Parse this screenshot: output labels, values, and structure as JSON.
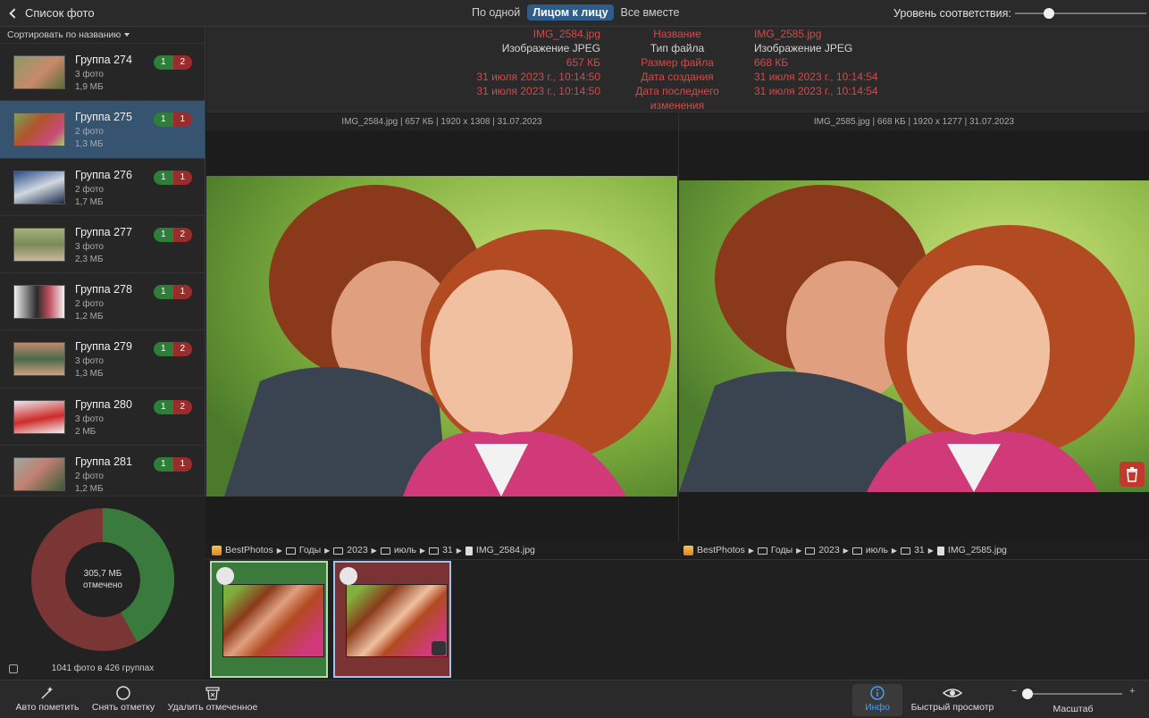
{
  "topbar": {
    "back_label": "Список фото",
    "modes": [
      {
        "label": "По одной",
        "active": false
      },
      {
        "label": "Лицом к лицу",
        "active": true
      },
      {
        "label": "Все вместе",
        "active": false
      }
    ],
    "match_level_label": "Уровень соответствия:",
    "match_level": 0.25
  },
  "sidebar": {
    "sort_label": "Сортировать по названию",
    "groups": [
      {
        "name": "Группа 274",
        "count": "3 фото",
        "size": "1,9 МБ",
        "keep": "1",
        "remove": "2",
        "selected": false
      },
      {
        "name": "Группа 275",
        "count": "2 фото",
        "size": "1,3 МБ",
        "keep": "1",
        "remove": "1",
        "selected": true
      },
      {
        "name": "Группа 276",
        "count": "2 фото",
        "size": "1,7 МБ",
        "keep": "1",
        "remove": "1",
        "selected": false
      },
      {
        "name": "Группа 277",
        "count": "3 фото",
        "size": "2,3 МБ",
        "keep": "1",
        "remove": "2",
        "selected": false
      },
      {
        "name": "Группа 278",
        "count": "2 фото",
        "size": "1,2 МБ",
        "keep": "1",
        "remove": "1",
        "selected": false
      },
      {
        "name": "Группа 279",
        "count": "3 фото",
        "size": "1,3 МБ",
        "keep": "1",
        "remove": "2",
        "selected": false
      },
      {
        "name": "Группа 280",
        "count": "3 фото",
        "size": "2 МБ",
        "keep": "1",
        "remove": "2",
        "selected": false
      },
      {
        "name": "Группа 281",
        "count": "2 фото",
        "size": "1,2 МБ",
        "keep": "1",
        "remove": "1",
        "selected": false
      }
    ],
    "donut": {
      "marked_label": "305,7 МБ",
      "marked_sub": "отмечено",
      "keep_fraction": 0.42,
      "colors": {
        "keep": "#3a7a3c",
        "remove": "#7a3535"
      }
    },
    "total_label": "1041 фото в 426 группах"
  },
  "info": {
    "rows": [
      {
        "left": "IMG_2584.jpg",
        "label": "Название",
        "right": "IMG_2585.jpg",
        "diff": true
      },
      {
        "left": "Изображение JPEG",
        "label": "Тип файла",
        "right": "Изображение JPEG",
        "diff": false
      },
      {
        "left": "657 КБ",
        "label": "Размер файла",
        "right": "668 КБ",
        "diff": true
      },
      {
        "left": "31 июля 2023 г., 10:14:50",
        "label": "Дата создания",
        "right": "31 июля 2023 г., 10:14:54",
        "diff": true
      },
      {
        "left": "31 июля 2023 г., 10:14:50",
        "label": "Дата последнего изменения",
        "right": "31 июля 2023 г., 10:14:54",
        "diff": true
      }
    ]
  },
  "panes": {
    "left": {
      "header": "IMG_2584.jpg | 657 КБ | 1920 x 1308 | 31.07.2023",
      "path": [
        "BestPhotos",
        "Годы",
        "2023",
        "июль",
        "31",
        "IMG_2584.jpg"
      ]
    },
    "right": {
      "header": "IMG_2585.jpg | 668 КБ | 1920 x 1277 | 31.07.2023",
      "path": [
        "BestPhotos",
        "Годы",
        "2023",
        "июль",
        "31",
        "IMG_2585.jpg"
      ]
    }
  },
  "toolbar": {
    "auto_mark": "Авто пометить",
    "unmark": "Снять отметку",
    "delete_marked": "Удалить отмеченное",
    "info": "Инфо",
    "quick_look": "Быстрый просмотр",
    "zoom": "Масштаб",
    "zoom_minus": "−",
    "zoom_plus": "+",
    "zoom_level": 0.05
  },
  "colors": {
    "accent": "#2f5d8a",
    "diff_red": "#d4494b",
    "keep_green": "#2e7d3a",
    "remove_red": "#9b2c2c"
  }
}
